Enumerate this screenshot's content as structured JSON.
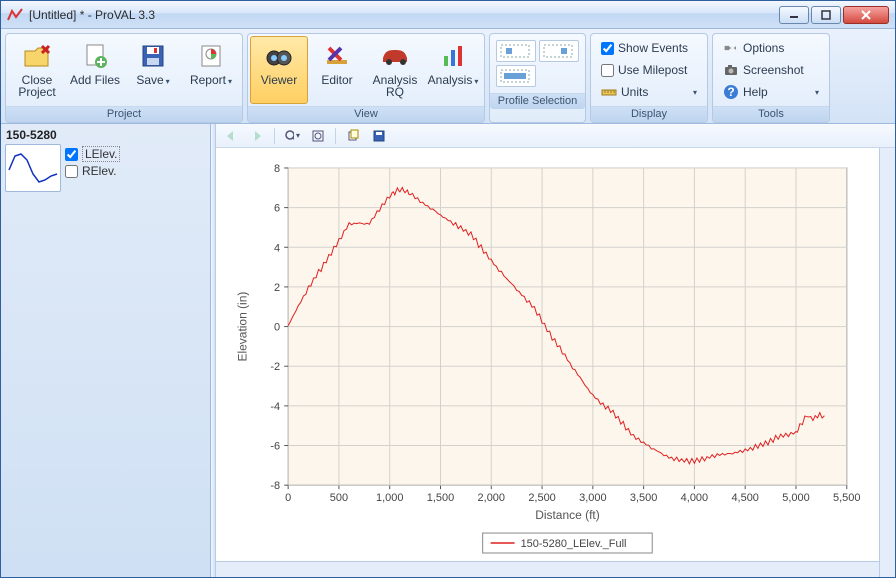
{
  "window": {
    "title": "[Untitled] * - ProVAL 3.3"
  },
  "ribbon": {
    "groups": {
      "project": {
        "title": "Project",
        "close_label": "Close Project",
        "addfiles_label": "Add Files",
        "save_label": "Save",
        "report_label": "Report"
      },
      "view": {
        "title": "View",
        "viewer_label": "Viewer",
        "editor_label": "Editor",
        "analysis_rq_label": "Analysis RQ",
        "analysis_label": "Analysis"
      },
      "profile_selection": {
        "title": "Profile Selection"
      },
      "display": {
        "title": "Display",
        "show_events_label": "Show Events",
        "use_milepost_label": "Use Milepost",
        "units_label": "Units"
      },
      "tools": {
        "title": "Tools",
        "options_label": "Options",
        "screenshot_label": "Screenshot",
        "help_label": "Help"
      }
    }
  },
  "sidebar": {
    "file_name": "150-5280",
    "layers": [
      {
        "label": "LElev.",
        "checked": true
      },
      {
        "label": "RElev.",
        "checked": false
      }
    ]
  },
  "display_state": {
    "show_events": true,
    "use_milepost": false
  },
  "chart_data": {
    "type": "line",
    "xlabel": "Distance (ft)",
    "ylabel": "Elevation (in)",
    "xlim": [
      0,
      5500
    ],
    "ylim": [
      -8,
      8
    ],
    "xticks": [
      0,
      500,
      1000,
      1500,
      2000,
      2500,
      3000,
      3500,
      4000,
      4500,
      5000,
      5500
    ],
    "yticks": [
      -8,
      -6,
      -4,
      -2,
      0,
      2,
      4,
      6,
      8
    ],
    "series": [
      {
        "name": "150-5280_LElev._Full",
        "color": "#e02020",
        "x": [
          0,
          200,
          400,
          600,
          800,
          1000,
          1100,
          1200,
          1400,
          1600,
          1800,
          2000,
          2200,
          2400,
          2600,
          2800,
          3000,
          3200,
          3400,
          3600,
          3800,
          4000,
          4200,
          4400,
          4600,
          4800,
          5000,
          5100,
          5280
        ],
        "y": [
          0.0,
          2.0,
          3.6,
          5.2,
          5.1,
          6.6,
          7.0,
          6.8,
          6.0,
          5.2,
          4.6,
          3.4,
          2.2,
          1.0,
          -0.6,
          -2.0,
          -3.4,
          -4.4,
          -5.6,
          -6.2,
          -6.6,
          -6.8,
          -6.6,
          -6.4,
          -6.0,
          -5.6,
          -5.4,
          -4.6,
          -4.5
        ]
      }
    ],
    "legend": "150-5280_LElev._Full"
  },
  "colors": {
    "plot_bg": "#fdf6ec",
    "grid": "#d3d1cd",
    "axis": "#555555",
    "series": "#e02020"
  }
}
